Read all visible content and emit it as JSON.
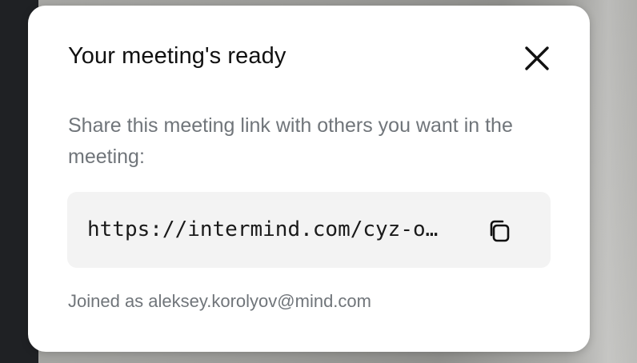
{
  "dialog": {
    "title": "Your meeting's ready",
    "close_icon": "close-icon",
    "description": "Share this meeting link with others you want in the meeting:",
    "meeting_link": "https://intermind.com/cyz-o…",
    "copy_icon": "copy-icon",
    "joined_prefix": "Joined as ",
    "joined_email": "aleksey.korolyov@mind.com"
  },
  "colors": {
    "title_text": "#111111",
    "secondary_text": "#70757a",
    "link_box_bg": "#f3f3f3",
    "dialog_bg": "#ffffff"
  }
}
